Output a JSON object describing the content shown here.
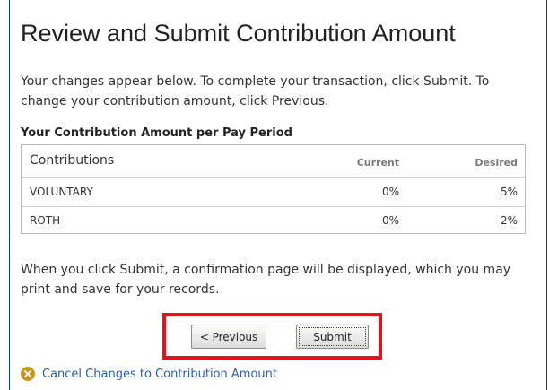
{
  "page": {
    "title": "Review and Submit Contribution Amount",
    "intro": "Your changes appear below. To complete your transaction, click Submit. To change your contribution amount, click Previous.",
    "section_label": "Your Contribution Amount per Pay Period",
    "confirm_text": "When you click Submit, a confirmation page will be displayed, which you may print and save for your records."
  },
  "table": {
    "headers": [
      "Contributions",
      "Current",
      "Desired"
    ],
    "rows": [
      {
        "name": "VOLUNTARY",
        "current": "0%",
        "desired": "5%"
      },
      {
        "name": "ROTH",
        "current": "0%",
        "desired": "2%"
      }
    ]
  },
  "buttons": {
    "previous": "< Previous",
    "submit": "Submit"
  },
  "cancel_link": {
    "label": "Cancel Changes to Contribution Amount",
    "icon": "close-circle-icon"
  },
  "colors": {
    "highlight": "#e0141b",
    "link": "#2d5fa6",
    "cancel_icon": "#c8961c",
    "frame_border": "#1f3a7a"
  }
}
